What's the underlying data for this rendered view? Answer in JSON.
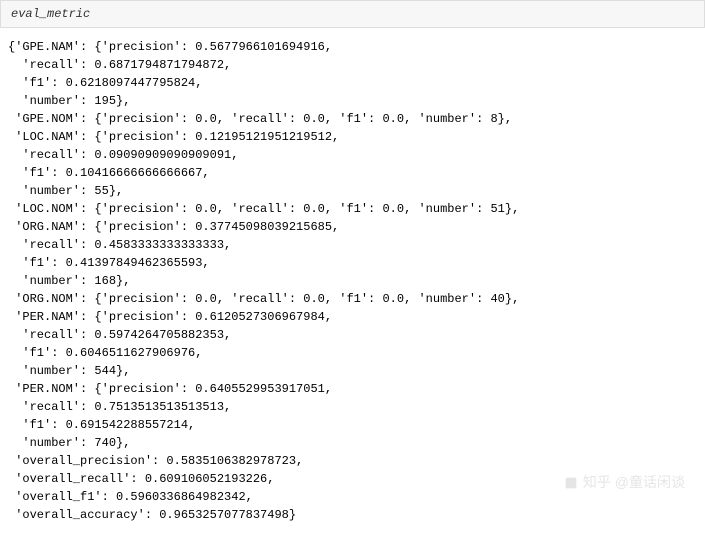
{
  "header": {
    "variable_name": "eval_metric"
  },
  "output": {
    "lines": [
      "{'GPE.NAM': {'precision': 0.5677966101694916,",
      "  'recall': 0.6871794871794872,",
      "  'f1': 0.6218097447795824,",
      "  'number': 195},",
      " 'GPE.NOM': {'precision': 0.0, 'recall': 0.0, 'f1': 0.0, 'number': 8},",
      " 'LOC.NAM': {'precision': 0.12195121951219512,",
      "  'recall': 0.09090909090909091,",
      "  'f1': 0.10416666666666667,",
      "  'number': 55},",
      " 'LOC.NOM': {'precision': 0.0, 'recall': 0.0, 'f1': 0.0, 'number': 51},",
      " 'ORG.NAM': {'precision': 0.37745098039215685,",
      "  'recall': 0.4583333333333333,",
      "  'f1': 0.41397849462365593,",
      "  'number': 168},",
      " 'ORG.NOM': {'precision': 0.0, 'recall': 0.0, 'f1': 0.0, 'number': 40},",
      " 'PER.NAM': {'precision': 0.6120527306967984,",
      "  'recall': 0.5974264705882353,",
      "  'f1': 0.6046511627906976,",
      "  'number': 544},",
      " 'PER.NOM': {'precision': 0.6405529953917051,",
      "  'recall': 0.7513513513513513,",
      "  'f1': 0.691542288557214,",
      "  'number': 740},",
      " 'overall_precision': 0.5835106382978723,",
      " 'overall_recall': 0.609106052193226,",
      " 'overall_f1': 0.5960336864982342,",
      " 'overall_accuracy': 0.9653257077837498}"
    ]
  },
  "watermark": {
    "text": "知乎 @童话闲谈"
  },
  "chart_data": {
    "type": "table",
    "title": "eval_metric",
    "entities": [
      {
        "name": "GPE.NAM",
        "precision": 0.5677966101694916,
        "recall": 0.6871794871794872,
        "f1": 0.6218097447795824,
        "number": 195
      },
      {
        "name": "GPE.NOM",
        "precision": 0.0,
        "recall": 0.0,
        "f1": 0.0,
        "number": 8
      },
      {
        "name": "LOC.NAM",
        "precision": 0.12195121951219512,
        "recall": 0.09090909090909091,
        "f1": 0.10416666666666667,
        "number": 55
      },
      {
        "name": "LOC.NOM",
        "precision": 0.0,
        "recall": 0.0,
        "f1": 0.0,
        "number": 51
      },
      {
        "name": "ORG.NAM",
        "precision": 0.37745098039215685,
        "recall": 0.4583333333333333,
        "f1": 0.41397849462365593,
        "number": 168
      },
      {
        "name": "ORG.NOM",
        "precision": 0.0,
        "recall": 0.0,
        "f1": 0.0,
        "number": 40
      },
      {
        "name": "PER.NAM",
        "precision": 0.6120527306967984,
        "recall": 0.5974264705882353,
        "f1": 0.6046511627906976,
        "number": 544
      },
      {
        "name": "PER.NOM",
        "precision": 0.6405529953917051,
        "recall": 0.7513513513513513,
        "f1": 0.691542288557214,
        "number": 740
      }
    ],
    "overall": {
      "overall_precision": 0.5835106382978723,
      "overall_recall": 0.609106052193226,
      "overall_f1": 0.5960336864982342,
      "overall_accuracy": 0.9653257077837498
    }
  }
}
